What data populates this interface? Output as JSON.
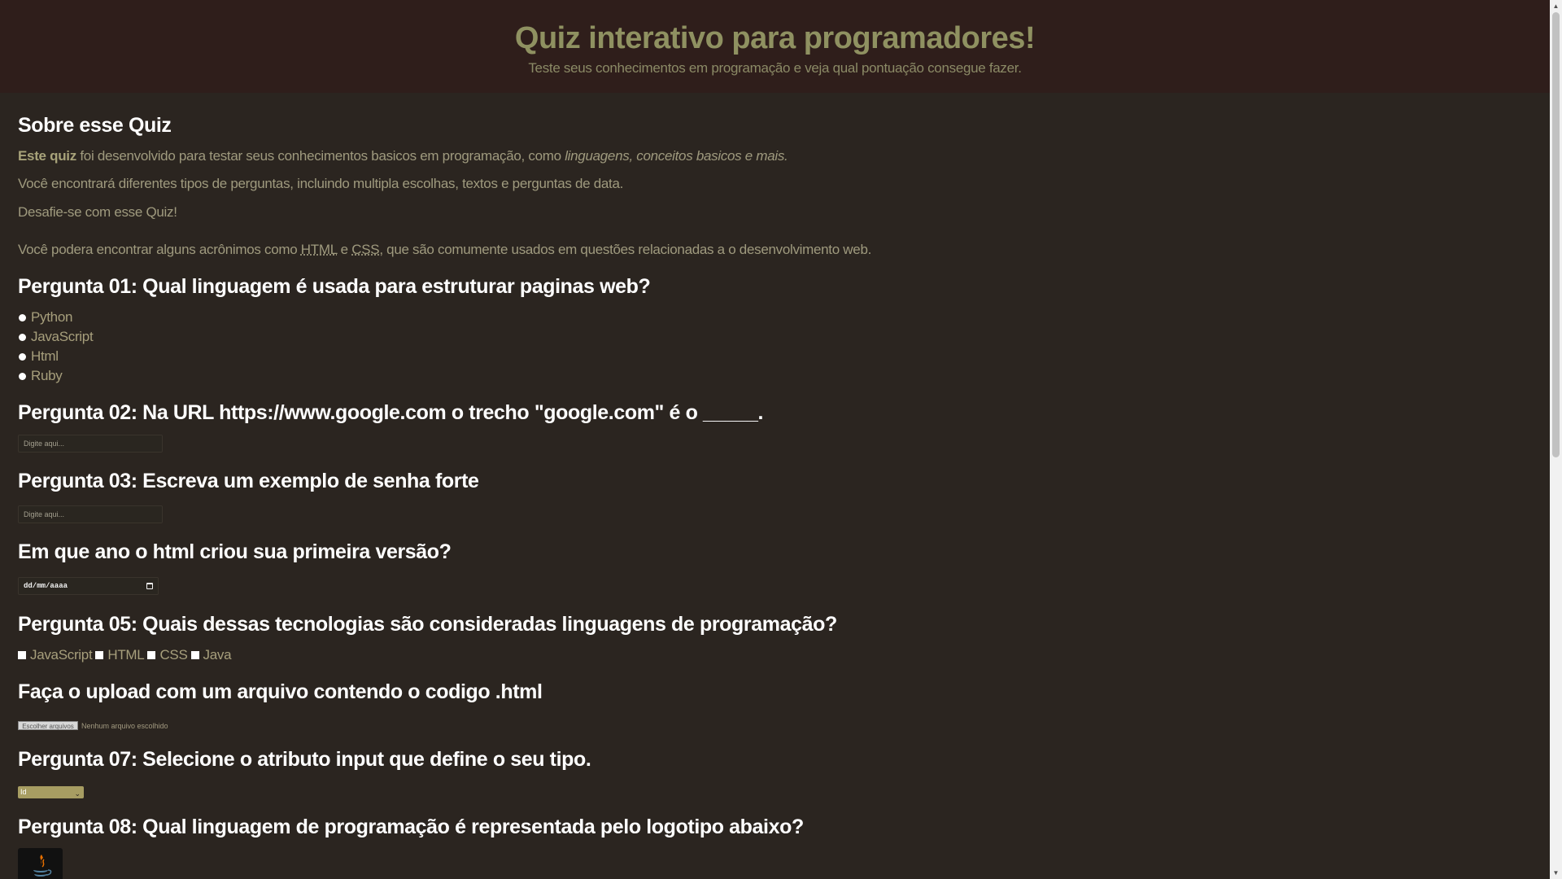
{
  "header": {
    "title": "Quiz interativo para programadores!",
    "subtitle": "Teste seus conhecimentos em programação e veja qual pontuação consegue fazer."
  },
  "about": {
    "heading": "Sobre esse Quiz",
    "p1_strong": "Este quiz",
    "p1_text": " foi desenvolvido para testar seus conhecimentos basicos em programação, como ",
    "p1_em": "linguagens, conceitos basicos e mais.",
    "p2": "Você encontrará diferentes tipos de perguntas, incluindo multipla escolhas, textos e perguntas de data.",
    "p3": "Desafie-se com esse Quiz!",
    "p4_a": "Você podera encontrar alguns acrônimos como ",
    "abbr_html": "HTML",
    "p4_b": " e ",
    "abbr_css": "CSS",
    "p4_c": ", que são comumente usados em questões relacionadas a o desenvolvimento web."
  },
  "q1": {
    "heading": "Pergunta 01: Qual linguagem é usada para estruturar paginas web?",
    "options": [
      "Python",
      "JavaScript",
      "Html",
      "Ruby"
    ]
  },
  "q2": {
    "heading": "Pergunta 02: Na URL https://www.google.com o trecho \"google.com\" é o _____.",
    "placeholder": "Digite aqui..."
  },
  "q3": {
    "heading": "Pergunta 03: Escreva um exemplo de senha forte",
    "placeholder": "Digite aqui..."
  },
  "q4": {
    "heading": "Em que ano o html criou sua primeira versão?",
    "date_placeholder": "dd/mm/aaaa",
    "icon": "calendar-icon"
  },
  "q5": {
    "heading": "Pergunta 05: Quais dessas tecnologias são consideradas linguagens de programação?",
    "options": [
      "JavaScript",
      "HTML",
      "CSS",
      "Java"
    ]
  },
  "q6": {
    "heading": "Faça o upload com um arquivo contendo o codigo .html",
    "button_label": "Escolher arquivos",
    "no_file": "Nenhum arquivo escolhido"
  },
  "q7": {
    "heading": "Pergunta 07: Selecione o atributo input que define o seu tipo.",
    "selected": "Id"
  },
  "q8": {
    "heading": "Pergunta 08: Qual linguagem de programação é representada pelo logotipo abaixo?",
    "logo": "java-logo-icon"
  },
  "colors": {
    "background": "#2b2520",
    "header_bg": "#2f1e1b",
    "title": "#8f9161",
    "heading": "#ffffff",
    "text": "#9f9a7e",
    "select_bg": "#a79d62"
  }
}
